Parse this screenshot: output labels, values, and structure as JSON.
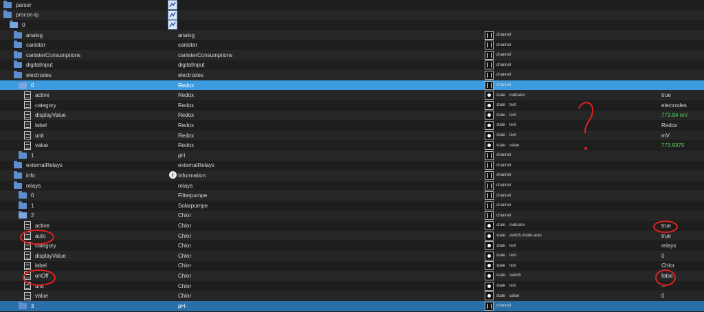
{
  "rows": [
    {
      "name": "parser",
      "indent": 0,
      "kind": "folder",
      "role": "",
      "type": "",
      "subtype": "",
      "value": "",
      "img": "img"
    },
    {
      "name": "procon-ip",
      "indent": 0,
      "kind": "folder",
      "role": "",
      "type": "",
      "subtype": "",
      "value": "",
      "img": "img"
    },
    {
      "name": "0",
      "indent": 1,
      "kind": "folder-open",
      "role": "",
      "type": "",
      "subtype": "",
      "value": "",
      "img": "img"
    },
    {
      "name": "analog",
      "indent": 2,
      "kind": "folder",
      "role": "analog",
      "type": "channel",
      "subtype": "",
      "value": ""
    },
    {
      "name": "canister",
      "indent": 2,
      "kind": "folder",
      "role": "canister",
      "type": "channel",
      "subtype": "",
      "value": ""
    },
    {
      "name": "canisterConsumptions",
      "indent": 2,
      "kind": "folder",
      "role": "canisterConsumptions",
      "type": "channel",
      "subtype": "",
      "value": ""
    },
    {
      "name": "digitalInput",
      "indent": 2,
      "kind": "folder",
      "role": "digitalInput",
      "type": "channel",
      "subtype": "",
      "value": ""
    },
    {
      "name": "electrodes",
      "indent": 2,
      "kind": "folder",
      "role": "electrodes",
      "type": "channel",
      "subtype": "",
      "value": ""
    },
    {
      "name": "0",
      "indent": 3,
      "kind": "folder-open",
      "role": "Redox",
      "type": "channel",
      "subtype": "",
      "value": "",
      "selected": true
    },
    {
      "name": "active",
      "indent": 4,
      "kind": "file",
      "role": "Redox",
      "type": "state",
      "subtype": "indicator",
      "value": "true"
    },
    {
      "name": "category",
      "indent": 4,
      "kind": "file",
      "role": "Redox",
      "type": "state",
      "subtype": "text",
      "value": "electrodes"
    },
    {
      "name": "displayValue",
      "indent": 4,
      "kind": "file",
      "role": "Redox",
      "type": "state",
      "subtype": "text",
      "value": "773.94 mV",
      "green": true
    },
    {
      "name": "label",
      "indent": 4,
      "kind": "file",
      "role": "Redox",
      "type": "state",
      "subtype": "text",
      "value": "Redox"
    },
    {
      "name": "unit",
      "indent": 4,
      "kind": "file",
      "role": "Redox",
      "type": "state",
      "subtype": "text",
      "value": "mV"
    },
    {
      "name": "value",
      "indent": 4,
      "kind": "file",
      "role": "Redox",
      "type": "state",
      "subtype": "value",
      "value": "773.9375",
      "green": true
    },
    {
      "name": "1",
      "indent": 3,
      "kind": "folder",
      "role": "pH",
      "type": "channel",
      "subtype": "",
      "value": ""
    },
    {
      "name": "externalRelays",
      "indent": 2,
      "kind": "folder",
      "role": "externalRelays",
      "type": "channel",
      "subtype": "",
      "value": ""
    },
    {
      "name": "info",
      "indent": 2,
      "kind": "folder",
      "role": "Information",
      "type": "channel",
      "subtype": "",
      "value": "",
      "info": true
    },
    {
      "name": "relays",
      "indent": 2,
      "kind": "folder",
      "role": "relays",
      "type": "channel",
      "subtype": "",
      "value": ""
    },
    {
      "name": "0",
      "indent": 3,
      "kind": "folder",
      "role": "Filterpumpe",
      "type": "channel",
      "subtype": "",
      "value": ""
    },
    {
      "name": "1",
      "indent": 3,
      "kind": "folder",
      "role": "Solarpumpe",
      "type": "channel",
      "subtype": "",
      "value": ""
    },
    {
      "name": "2",
      "indent": 3,
      "kind": "folder-open",
      "role": "Chlor",
      "type": "channel",
      "subtype": "",
      "value": ""
    },
    {
      "name": "active",
      "indent": 4,
      "kind": "file",
      "role": "Chlor",
      "type": "state",
      "subtype": "indicator",
      "value": "true"
    },
    {
      "name": "auto",
      "indent": 4,
      "kind": "file",
      "role": "Chlor",
      "type": "state",
      "subtype": "switch.mode.auto",
      "value": "true"
    },
    {
      "name": "category",
      "indent": 4,
      "kind": "file",
      "role": "Chlor",
      "type": "state",
      "subtype": "text",
      "value": "relays"
    },
    {
      "name": "displayValue",
      "indent": 4,
      "kind": "file",
      "role": "Chlor",
      "type": "state",
      "subtype": "text",
      "value": "0"
    },
    {
      "name": "label",
      "indent": 4,
      "kind": "file",
      "role": "Chlor",
      "type": "state",
      "subtype": "text",
      "value": "Chlor"
    },
    {
      "name": "onOff",
      "indent": 4,
      "kind": "file",
      "role": "Chlor",
      "type": "state",
      "subtype": "switch",
      "value": "false"
    },
    {
      "name": "unit",
      "indent": 4,
      "kind": "file",
      "role": "Chlor",
      "type": "state",
      "subtype": "text",
      "value": "--"
    },
    {
      "name": "value",
      "indent": 4,
      "kind": "file",
      "role": "Chlor",
      "type": "state",
      "subtype": "value",
      "value": "0"
    },
    {
      "name": "3",
      "indent": 3,
      "kind": "folder",
      "role": "pH-",
      "type": "channel",
      "subtype": "",
      "value": "",
      "selectedBottom": true
    }
  ],
  "annotations": {
    "question_mark": "?"
  },
  "colors": {
    "background": "#1e1e1e",
    "selected_row": "#3d9be0",
    "green_value": "#59d659",
    "annotation_red": "#e02020"
  }
}
